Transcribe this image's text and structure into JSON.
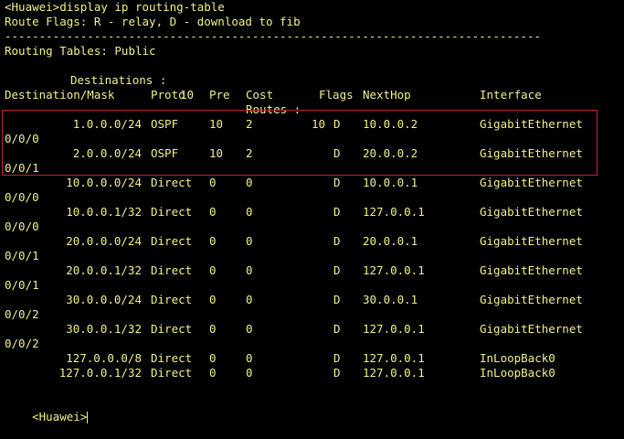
{
  "window": {
    "background": "#000000",
    "text_color": "#f0f08a",
    "highlight_color": "#c8202a"
  },
  "terminal": {
    "command_line": "<Huawei>display ip routing-table",
    "flags_line": "Route Flags: R - relay, D - download to fib",
    "separator": "------------------------------------------------------------------------------",
    "table_title": "Routing Tables: Public",
    "summary": {
      "destinations_label": "Destinations :",
      "destinations_value": "10",
      "routes_label": "Routes :",
      "routes_value": "10"
    },
    "headers": {
      "destination": "Destination/Mask",
      "proto": "Proto",
      "pre": "Pre",
      "cost": "Cost",
      "flags": "Flags",
      "nexthop": "NextHop",
      "interface": "Interface"
    },
    "routes": [
      {
        "dest": "1.0.0.0/24",
        "proto": "OSPF",
        "pre": "10",
        "cost": "2",
        "flags": "D",
        "nexthop": "10.0.0.2",
        "iface": "GigabitEthernet",
        "iface_cont": "0/0/0"
      },
      {
        "dest": "2.0.0.0/24",
        "proto": "OSPF",
        "pre": "10",
        "cost": "2",
        "flags": "D",
        "nexthop": "20.0.0.2",
        "iface": "GigabitEthernet",
        "iface_cont": "0/0/1"
      },
      {
        "dest": "10.0.0.0/24",
        "proto": "Direct",
        "pre": "0",
        "cost": "0",
        "flags": "D",
        "nexthop": "10.0.0.1",
        "iface": "GigabitEthernet",
        "iface_cont": "0/0/0"
      },
      {
        "dest": "10.0.0.1/32",
        "proto": "Direct",
        "pre": "0",
        "cost": "0",
        "flags": "D",
        "nexthop": "127.0.0.1",
        "iface": "GigabitEthernet",
        "iface_cont": "0/0/0"
      },
      {
        "dest": "20.0.0.0/24",
        "proto": "Direct",
        "pre": "0",
        "cost": "0",
        "flags": "D",
        "nexthop": "20.0.0.1",
        "iface": "GigabitEthernet",
        "iface_cont": "0/0/1"
      },
      {
        "dest": "20.0.0.1/32",
        "proto": "Direct",
        "pre": "0",
        "cost": "0",
        "flags": "D",
        "nexthop": "127.0.0.1",
        "iface": "GigabitEthernet",
        "iface_cont": "0/0/1"
      },
      {
        "dest": "30.0.0.0/24",
        "proto": "Direct",
        "pre": "0",
        "cost": "0",
        "flags": "D",
        "nexthop": "30.0.0.1",
        "iface": "GigabitEthernet",
        "iface_cont": "0/0/2"
      },
      {
        "dest": "30.0.0.1/32",
        "proto": "Direct",
        "pre": "0",
        "cost": "0",
        "flags": "D",
        "nexthop": "127.0.0.1",
        "iface": "GigabitEthernet",
        "iface_cont": "0/0/2"
      },
      {
        "dest": "127.0.0.0/8",
        "proto": "Direct",
        "pre": "0",
        "cost": "0",
        "flags": "D",
        "nexthop": "127.0.0.1",
        "iface": "InLoopBack0",
        "iface_cont": ""
      },
      {
        "dest": "127.0.0.1/32",
        "proto": "Direct",
        "pre": "0",
        "cost": "0",
        "flags": "D",
        "nexthop": "127.0.0.1",
        "iface": "InLoopBack0",
        "iface_cont": ""
      }
    ],
    "prompt": "<Huawei>"
  }
}
